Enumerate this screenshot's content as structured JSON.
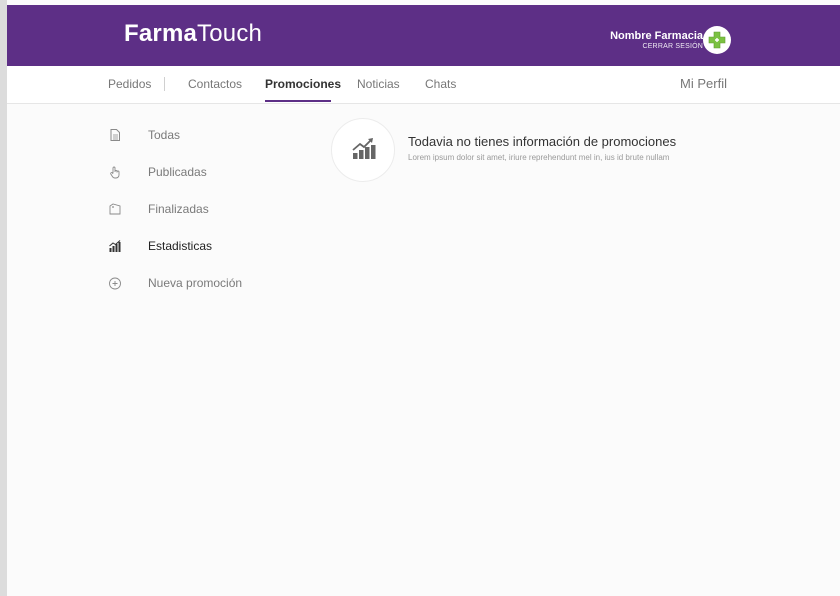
{
  "brand": {
    "bold": "Farma",
    "light": "Touch"
  },
  "account": {
    "name": "Nombre Farmacia",
    "logout": "CERRAR SESIÓN"
  },
  "nav": {
    "items": [
      {
        "label": "Pedidos"
      },
      {
        "label": "Contactos"
      },
      {
        "label": "Promociones",
        "active": true
      },
      {
        "label": "Noticias"
      },
      {
        "label": "Chats"
      }
    ],
    "profile": "Mi Perfil"
  },
  "sidebar": {
    "items": [
      {
        "label": "Todas",
        "icon": "document-icon"
      },
      {
        "label": "Publicadas",
        "icon": "hand-pointer-icon"
      },
      {
        "label": "Finalizadas",
        "icon": "tag-icon"
      },
      {
        "label": "Estadisticas",
        "icon": "stats-icon",
        "active": true
      },
      {
        "label": "Nueva promoción",
        "icon": "plus-circle-icon"
      }
    ]
  },
  "empty_state": {
    "icon": "trending-chart-icon",
    "title": "Todavia no tienes información de promociones",
    "description": "Lorem ipsum dolor sit amet, iriure reprehendunt mel in, ius id brute nullam"
  },
  "colors": {
    "brand_purple": "#5d2f86",
    "accent_green": "#7bc142"
  }
}
